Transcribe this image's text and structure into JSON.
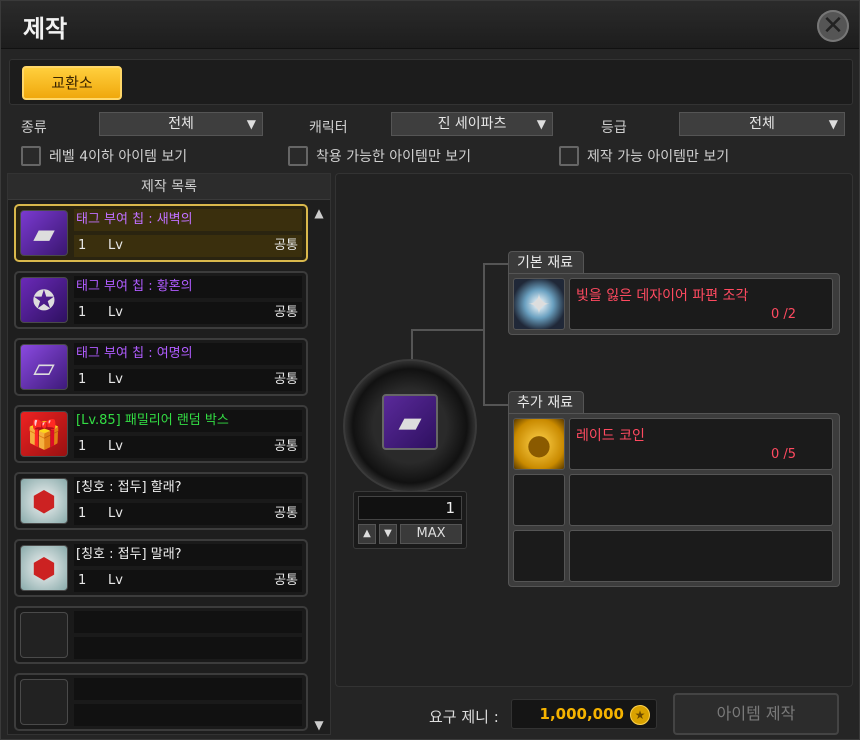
{
  "window": {
    "title": "제작"
  },
  "tabs": [
    {
      "label": "교환소"
    }
  ],
  "filters": {
    "type_label": "종류",
    "type_value": "전체",
    "character_label": "캐릭터",
    "character_value": "진 세이파츠",
    "grade_label": "등급",
    "grade_value": "전체"
  },
  "checkboxes": [
    {
      "label": "레벨 4이하 아이템 보기",
      "checked": false
    },
    {
      "label": "착용 가능한 아이템만 보기",
      "checked": false
    },
    {
      "label": "제작 가능 아이템만 보기",
      "checked": false
    }
  ],
  "list": {
    "header": "제작 목록",
    "items": [
      {
        "name": "태그 부여 칩 : 새벽의",
        "qty": "1",
        "lv": "Lv",
        "category": "공통",
        "name_color": "#b05cff",
        "icon": "chip-icon",
        "selected": true
      },
      {
        "name": "태그 부여 칩 : 황혼의",
        "qty": "1",
        "lv": "Lv",
        "category": "공통",
        "name_color": "#b05cff",
        "icon": "chip-icon",
        "selected": false
      },
      {
        "name": "태그 부여 칩 : 여명의",
        "qty": "1",
        "lv": "Lv",
        "category": "공통",
        "name_color": "#b05cff",
        "icon": "chip-icon",
        "selected": false
      },
      {
        "name": "[Lv.85] 패밀리어 랜덤 박스",
        "qty": "1",
        "lv": "Lv",
        "category": "공통",
        "name_color": "#33dd44",
        "icon": "gift-box-icon",
        "selected": false
      },
      {
        "name": "[칭호 : 접두] 할래?",
        "qty": "1",
        "lv": "Lv",
        "category": "공통",
        "name_color": "#f2f2f2",
        "icon": "title-badge-icon",
        "selected": false
      },
      {
        "name": "[칭호 : 접두] 말래?",
        "qty": "1",
        "lv": "Lv",
        "category": "공통",
        "name_color": "#f2f2f2",
        "icon": "title-badge-icon",
        "selected": false
      }
    ]
  },
  "craft": {
    "quantity": "1",
    "max_label": "MAX",
    "basic_materials_label": "기본 재료",
    "basic_materials": [
      {
        "name": "빛을 잃은 데자이어 파편 조각",
        "count": "0 /2",
        "icon": "shard-icon"
      }
    ],
    "extra_materials_label": "추가 재료",
    "extra_materials": [
      {
        "name": "레이드 코인",
        "count": "0 /5",
        "icon": "coin-icon"
      }
    ],
    "required_zeny_label": "요구 제니 :",
    "required_zeny": "1,000,000",
    "craft_button_label": "아이템 제작"
  },
  "colors": {
    "accent": "#f0a80c",
    "material_missing": "#ff4a60",
    "zeny": "#f5b300"
  }
}
